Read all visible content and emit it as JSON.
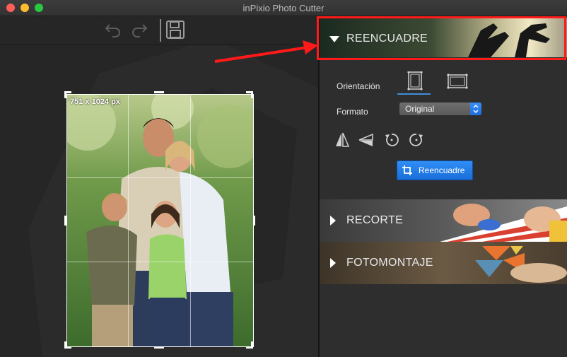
{
  "window": {
    "title": "inPixio Photo Cutter"
  },
  "toolbar": {
    "undo_icon": "undo-icon",
    "redo_icon": "redo-icon",
    "save_icon": "save-icon"
  },
  "canvas": {
    "size_label": "751 x 1024 px",
    "photo_description_icon": "family-photo"
  },
  "panel": {
    "reencuadre": {
      "title": "REENCUADRE",
      "expanded": true,
      "orientation_label": "Orientación",
      "format_label": "Formato",
      "format_value": "Original",
      "apply_button": "Reencuadre",
      "tools": [
        "flip-horizontal-icon",
        "flip-vertical-icon",
        "rotate-left-icon",
        "rotate-right-icon"
      ]
    },
    "recorte": {
      "title": "RECORTE",
      "expanded": false
    },
    "fotomontaje": {
      "title": "FOTOMONTAJE",
      "expanded": false
    }
  },
  "colors": {
    "accent": "#1f6fe0",
    "highlight": "#ff1a1a"
  }
}
